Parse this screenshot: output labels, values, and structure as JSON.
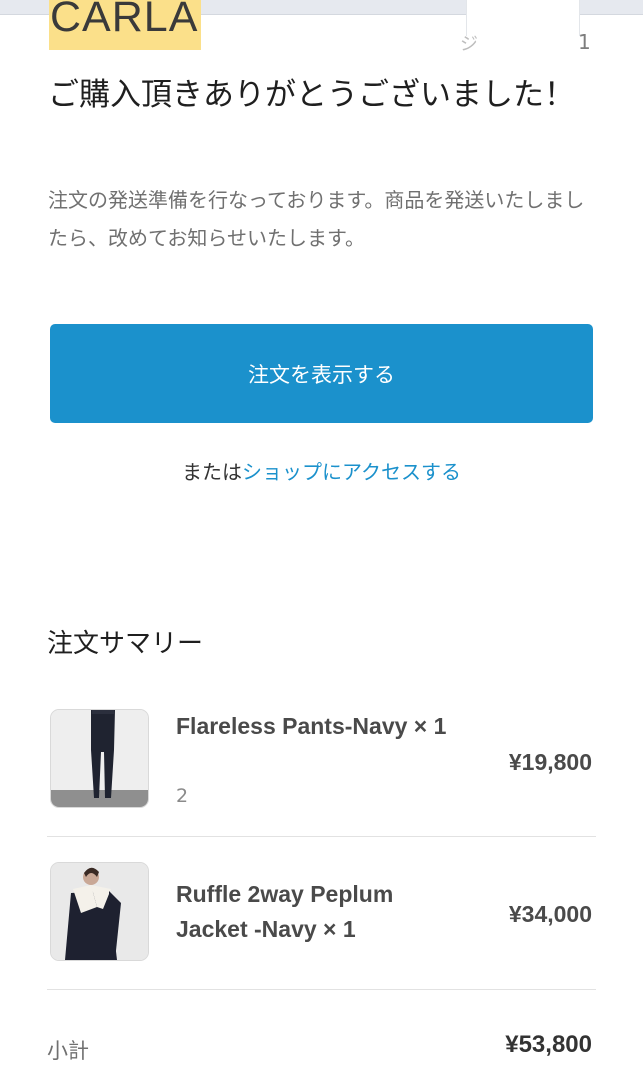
{
  "header": {
    "logo_text": "CARLA",
    "partial_mark": "ジ",
    "partial_number": "1"
  },
  "confirmation": {
    "title": "ご購入頂きありがとうございました！",
    "message": "注文の発送準備を行なっております。商品を発送いたしましたら、改めてお知らせいたします。",
    "view_order_label": "注文を表示する",
    "or_label": "または",
    "shop_link_label": "ショップにアクセスする"
  },
  "summary": {
    "title": "注文サマリー",
    "items": [
      {
        "name": "Flareless Pants-Navy × 1",
        "variant": "2",
        "price": "¥19,800",
        "thumbnail_icon": "pants-product-image"
      },
      {
        "name": "Ruffle 2way Peplum Jacket -Navy × 1",
        "variant": "",
        "price": "¥34,000",
        "thumbnail_icon": "jacket-product-image"
      }
    ],
    "subtotal_label": "小計",
    "subtotal_value": "¥53,800"
  },
  "colors": {
    "accent": "#1b91cc",
    "logo_highlight": "#fbe08a",
    "text_primary": "#1f1f1f",
    "text_secondary": "#707070"
  }
}
